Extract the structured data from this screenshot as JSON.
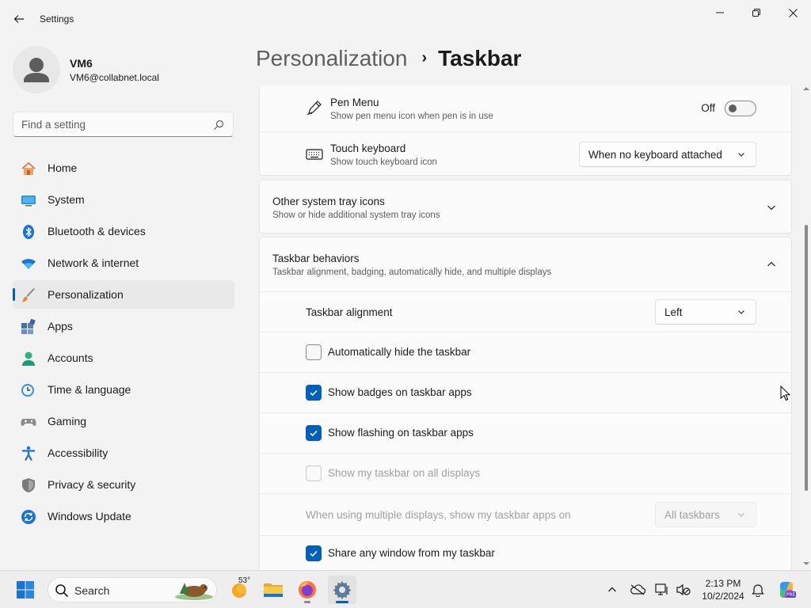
{
  "window": {
    "title": "Settings"
  },
  "user": {
    "name": "VM6",
    "email": "VM6@collabnet.local"
  },
  "search": {
    "placeholder": "Find a setting"
  },
  "sidebar": {
    "items": [
      {
        "label": "Home",
        "icon": "home-icon"
      },
      {
        "label": "System",
        "icon": "system-icon"
      },
      {
        "label": "Bluetooth & devices",
        "icon": "bluetooth-icon"
      },
      {
        "label": "Network & internet",
        "icon": "wifi-icon"
      },
      {
        "label": "Personalization",
        "icon": "brush-icon",
        "active": true
      },
      {
        "label": "Apps",
        "icon": "apps-icon"
      },
      {
        "label": "Accounts",
        "icon": "accounts-icon"
      },
      {
        "label": "Time & language",
        "icon": "clock-globe-icon"
      },
      {
        "label": "Gaming",
        "icon": "gamepad-icon"
      },
      {
        "label": "Accessibility",
        "icon": "accessibility-icon"
      },
      {
        "label": "Privacy & security",
        "icon": "shield-icon"
      },
      {
        "label": "Windows Update",
        "icon": "update-icon"
      }
    ]
  },
  "breadcrumb": {
    "parent": "Personalization",
    "separator": "›",
    "current": "Taskbar"
  },
  "settings": {
    "pen_menu": {
      "title": "Pen Menu",
      "subtitle": "Show pen menu icon when pen is in use",
      "state_label": "Off",
      "on": false
    },
    "touch_keyboard": {
      "title": "Touch keyboard",
      "subtitle": "Show touch keyboard icon",
      "value": "When no keyboard attached"
    },
    "other_tray": {
      "title": "Other system tray icons",
      "subtitle": "Show or hide additional system tray icons",
      "expanded": false
    },
    "behaviors": {
      "title": "Taskbar behaviors",
      "subtitle": "Taskbar alignment, badging, automatically hide, and multiple displays",
      "expanded": true
    },
    "alignment": {
      "label": "Taskbar alignment",
      "value": "Left"
    },
    "auto_hide": {
      "label": "Automatically hide the taskbar",
      "checked": false
    },
    "badges": {
      "label": "Show badges on taskbar apps",
      "checked": true
    },
    "flashing": {
      "label": "Show flashing on taskbar apps",
      "checked": true
    },
    "all_displays": {
      "label": "Show my taskbar on all displays",
      "checked": false,
      "disabled": true
    },
    "multi_display": {
      "label": "When using multiple displays, show my taskbar apps on",
      "value": "All taskbars",
      "disabled": true
    },
    "share_window": {
      "label": "Share any window from my taskbar",
      "checked": true
    }
  },
  "taskbar": {
    "search_label": "Search",
    "weather_temp": "53°",
    "time": "2:13 PM",
    "date": "10/2/2024",
    "apps": [
      "weather-icon",
      "file-explorer-icon",
      "firefox-icon",
      "settings-gear-icon"
    ]
  },
  "colors": {
    "accent": "#005fb8",
    "background": "#f3f3f3",
    "card": "#fbfbfb"
  }
}
